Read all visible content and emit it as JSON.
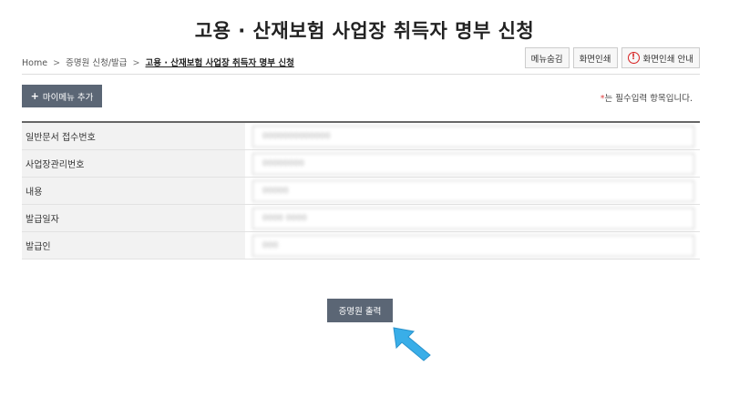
{
  "page": {
    "title": "고용 · 산재보험 사업장 취득자 명부 신청"
  },
  "breadcrumb": {
    "items": [
      "Home",
      "증명원 신청/발급"
    ],
    "separator": ">",
    "current": "고용 · 산재보험 사업장 취득자 명부 신청"
  },
  "toolbar": {
    "hide_menu_label": "메뉴숨김",
    "print_screen_label": "화면인쇄",
    "print_guide_label": "화면인쇄 안내",
    "print_guide_icon": "alert-circle-icon",
    "accent_color": "#d62020"
  },
  "actions": {
    "add_my_menu_label": "마이메뉴 추가",
    "add_icon": "+",
    "print_certificate_label": "증명원 출력"
  },
  "notice": {
    "star": "*",
    "text": "는 필수입력 항목입니다."
  },
  "form": {
    "rows": [
      {
        "label": "일반문서 접수번호",
        "value": "0000000000000"
      },
      {
        "label": "사업장관리번호",
        "value": "00000000"
      },
      {
        "label": "내용",
        "value": "00000"
      },
      {
        "label": "발급일자",
        "value": "0000 0000"
      },
      {
        "label": "발급인",
        "value": "000"
      }
    ]
  },
  "colors": {
    "button_bg": "#5b6675",
    "arrow": "#39aee8"
  }
}
